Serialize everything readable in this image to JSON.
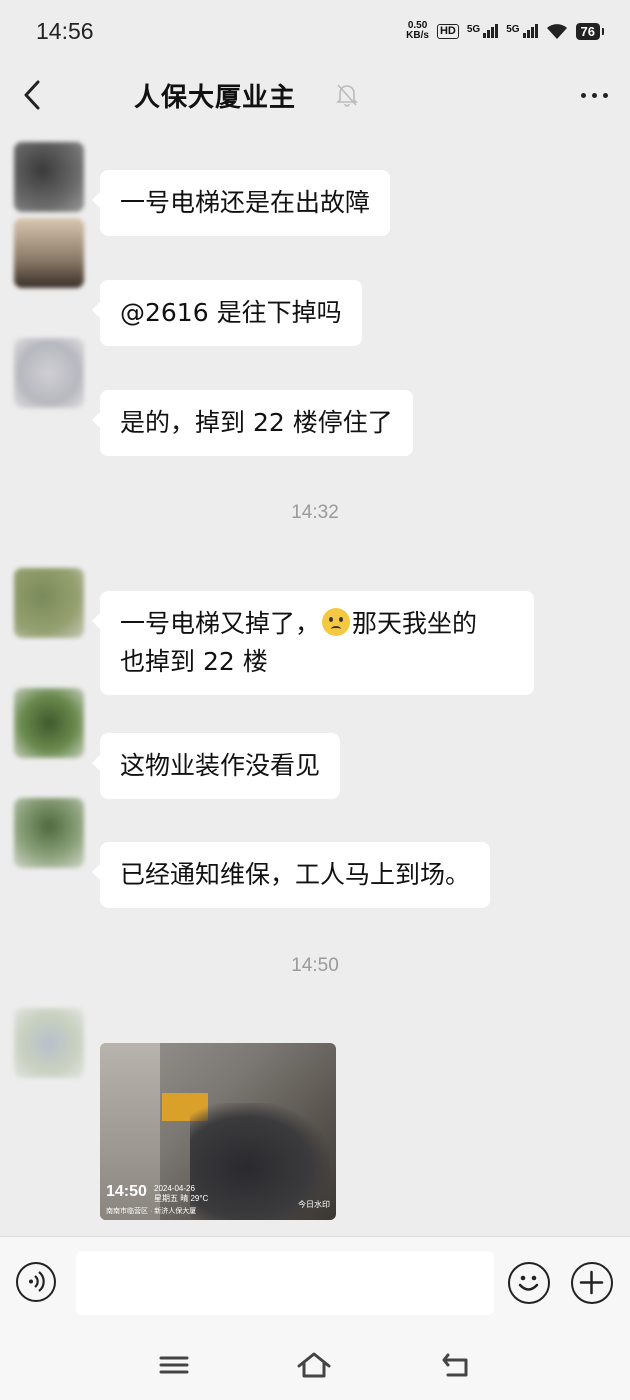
{
  "status_bar": {
    "time": "14:56",
    "net_speed_value": "0.50",
    "net_speed_unit": "KB/s",
    "hd_label": "HD",
    "sim1_label": "5G",
    "sim2_label": "5G",
    "battery": "76"
  },
  "header": {
    "title": "人保大厦业主"
  },
  "messages": [
    {
      "type": "text",
      "text": "一号电梯还是在出故障"
    },
    {
      "type": "text",
      "text": "@2616  是往下掉吗"
    },
    {
      "type": "text",
      "text": "是的，掉到 22 楼停住了"
    },
    {
      "type": "time",
      "text": "14:32"
    },
    {
      "type": "text",
      "text_line1_a": "一号电梯又掉了，",
      "emoji": "pleading-face-emoji",
      "text_line1_b": "那天我坐的",
      "text_line2": "也掉到 22 楼"
    },
    {
      "type": "text",
      "text": "这物业装作没看见"
    },
    {
      "type": "text",
      "text": "已经通知维保，工人马上到场。"
    },
    {
      "type": "time",
      "text": "14:50"
    },
    {
      "type": "image",
      "overlay_time": "14:50",
      "overlay_date": "2024-04-26",
      "overlay_weekday_weather": "星期五 晴 29°C",
      "overlay_location": "南南市临营区 · 新济人保大厦",
      "overlay_brand": "今日水印"
    }
  ],
  "icons": {
    "back": "back-arrow-icon",
    "mute": "bell-muted-icon",
    "more": "more-dots-icon",
    "voice": "voice-icon",
    "emoji": "smiley-icon",
    "plus": "plus-icon",
    "menu": "menu-icon",
    "home": "home-icon",
    "back_nav": "back-nav-icon"
  }
}
